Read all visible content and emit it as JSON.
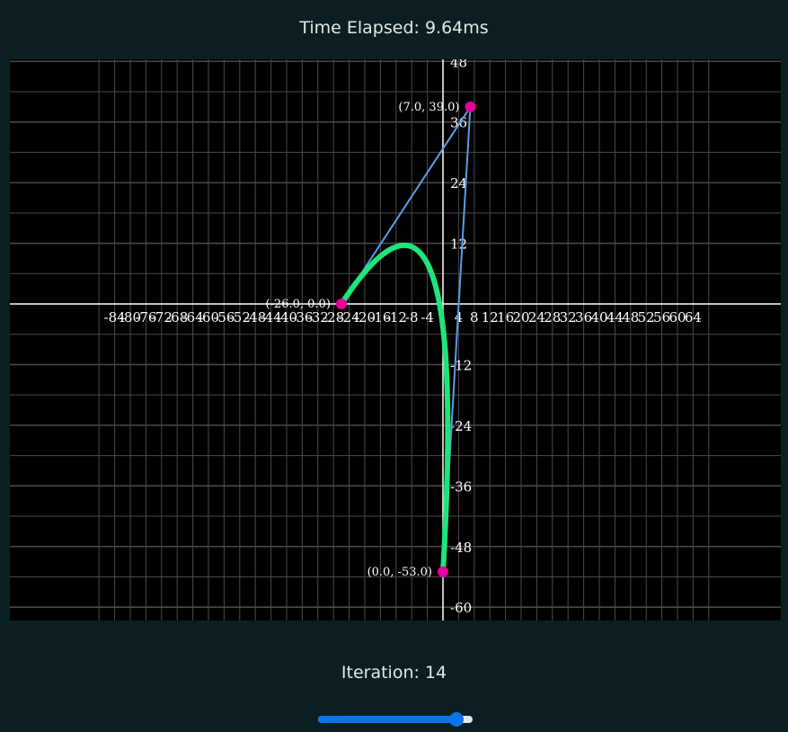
{
  "header": {
    "time_text": "Time Elapsed: 9.64ms"
  },
  "footer": {
    "iteration_text": "Iteration: 14",
    "slider": {
      "value": 14,
      "min": 0,
      "max": 15
    }
  },
  "colors": {
    "background": "#0b1f22",
    "plot_background": "#000000",
    "grid": "#4a4a4a",
    "axis": "#ffffff",
    "control_polygon": "#5b9de6",
    "curve": "#1ee57a",
    "control_point": "#e6009a",
    "slider_accent": "#0b74e8"
  },
  "chart_data": {
    "type": "line",
    "title": "",
    "xlabel": "",
    "ylabel": "",
    "xlim": [
      -88,
      66
    ],
    "ylim": [
      -62,
      48
    ],
    "x_ticks": [
      -84,
      -80,
      -76,
      -72,
      -68,
      -64,
      -60,
      -56,
      -52,
      -48,
      -44,
      -40,
      -36,
      -32,
      -28,
      -24,
      -20,
      -16,
      -12,
      -8,
      -4,
      4,
      8,
      12,
      16,
      20,
      24,
      28,
      32,
      36,
      40,
      44,
      48,
      52,
      56,
      60,
      64
    ],
    "y_ticks": [
      48,
      36,
      24,
      12,
      -12,
      -24,
      -36,
      -48,
      -60
    ],
    "grid": true,
    "control_points": [
      {
        "x": -26,
        "y": 0,
        "label": "(-26.0, 0.0)"
      },
      {
        "x": 7,
        "y": 39,
        "label": "(7.0, 39.0)"
      },
      {
        "x": 0,
        "y": -53,
        "label": "(0.0, -53.0)"
      }
    ],
    "series": [
      {
        "kind": "control-polygon",
        "x": [
          -26,
          7,
          0
        ],
        "y": [
          0,
          39,
          -53
        ]
      },
      {
        "kind": "bezier-curve",
        "degree": 2
      }
    ]
  }
}
